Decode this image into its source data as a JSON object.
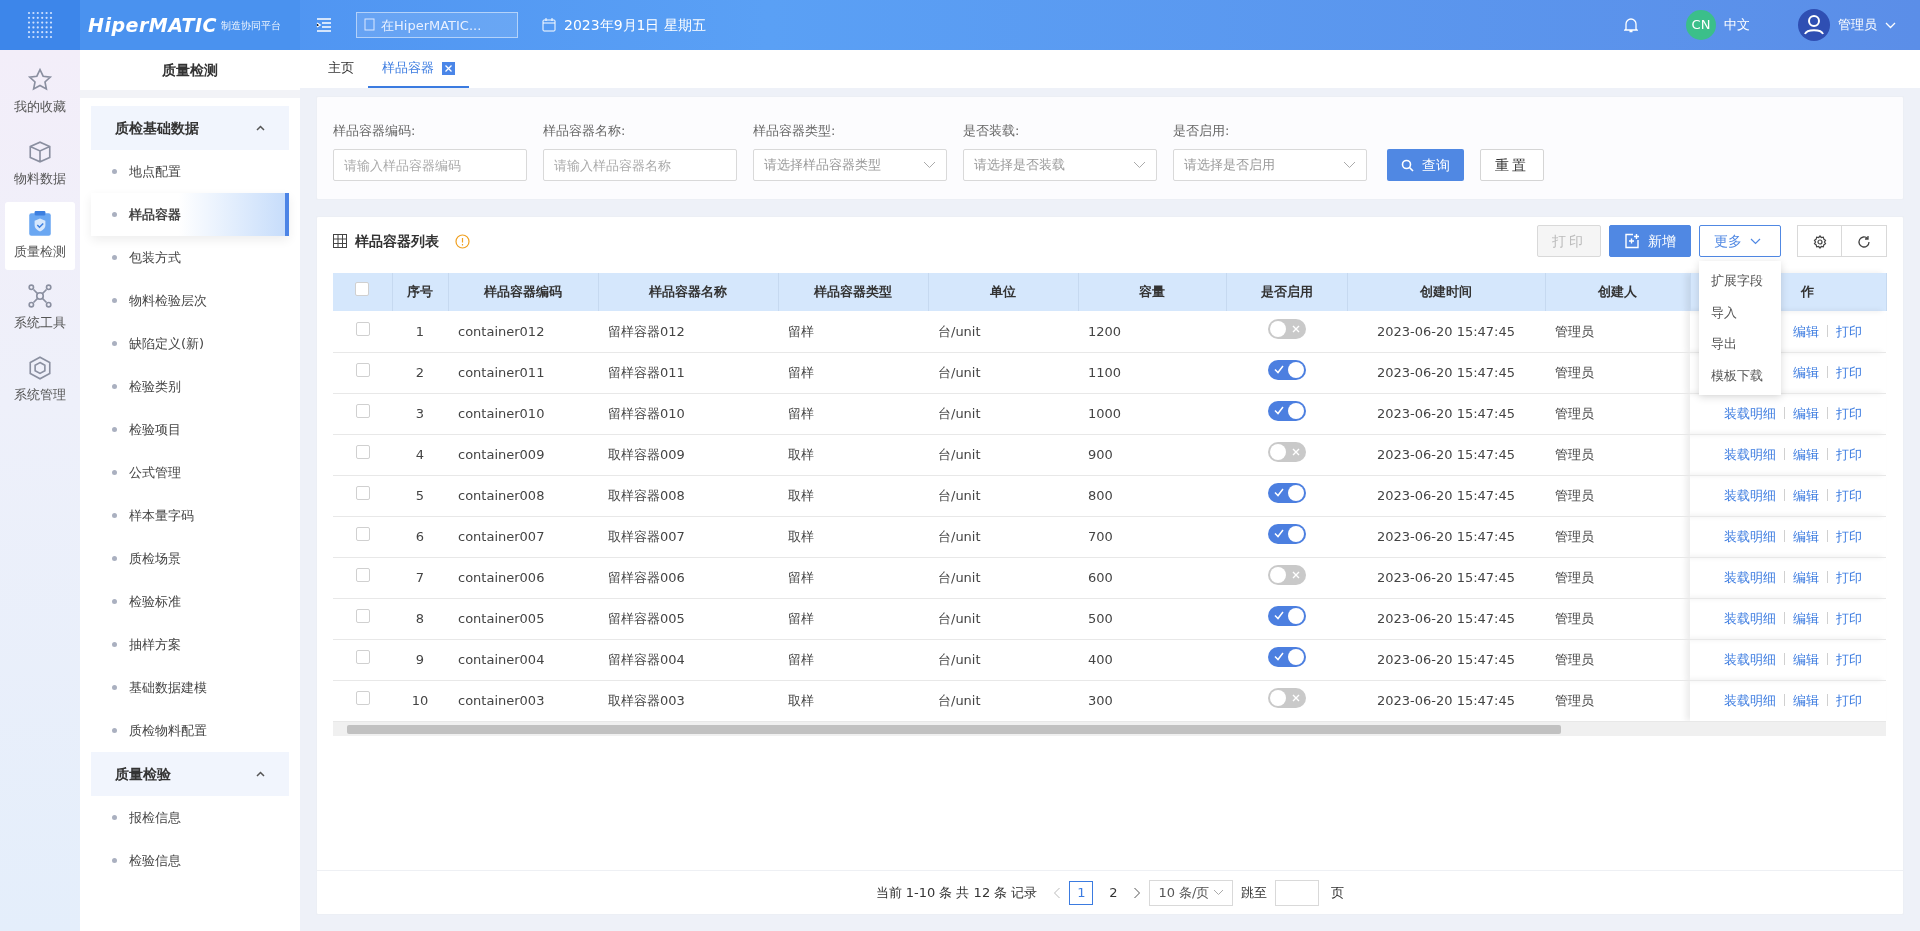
{
  "topbar": {
    "brand": "HiperMATIC",
    "subtitle": "制造协同平台",
    "search": {
      "placeholder": "在HiperMATIC..."
    },
    "date": "2023年9月1日 星期五",
    "language_badge": "CN",
    "language": "中文",
    "user": "管理员"
  },
  "rail": [
    {
      "label": "我的收藏",
      "selected": false
    },
    {
      "label": "物料数据",
      "selected": false
    },
    {
      "label": "质量检测",
      "selected": true
    },
    {
      "label": "系统工具",
      "selected": false
    },
    {
      "label": "系统管理",
      "selected": false
    }
  ],
  "sidebar": {
    "title": "质量检测",
    "groups": [
      {
        "label": "质检基础数据",
        "expanded": true,
        "children": [
          {
            "label": "地点配置",
            "selected": false
          },
          {
            "label": "样品容器",
            "selected": true
          },
          {
            "label": "包装方式",
            "selected": false
          },
          {
            "label": "物料检验层次",
            "selected": false
          },
          {
            "label": "缺陷定义(新)",
            "selected": false
          },
          {
            "label": "检验类别",
            "selected": false
          },
          {
            "label": "检验项目",
            "selected": false
          },
          {
            "label": "公式管理",
            "selected": false
          },
          {
            "label": "样本量字码",
            "selected": false
          },
          {
            "label": "质检场景",
            "selected": false
          },
          {
            "label": "检验标准",
            "selected": false
          },
          {
            "label": "抽样方案",
            "selected": false
          },
          {
            "label": "基础数据建模",
            "selected": false
          },
          {
            "label": "质检物料配置",
            "selected": false
          }
        ]
      },
      {
        "label": "质量检验",
        "expanded": true,
        "children": [
          {
            "label": "报检信息",
            "selected": false
          },
          {
            "label": "检验信息",
            "selected": false
          }
        ]
      }
    ]
  },
  "tabs": [
    {
      "label": "主页",
      "selected": false,
      "closable": false
    },
    {
      "label": "样品容器",
      "selected": true,
      "closable": true
    }
  ],
  "filters": [
    {
      "label": "样品容器编码:",
      "placeholder": "请输入样品容器编码",
      "kind": "input"
    },
    {
      "label": "样品容器名称:",
      "placeholder": "请输入样品容器名称",
      "kind": "input"
    },
    {
      "label": "样品容器类型:",
      "placeholder": "请选择样品容器类型",
      "kind": "select"
    },
    {
      "label": "是否装载:",
      "placeholder": "请选择是否装载",
      "kind": "select"
    },
    {
      "label": "是否启用:",
      "placeholder": "请选择是否启用",
      "kind": "select"
    }
  ],
  "filter_buttons": [
    {
      "label": "查询",
      "kind": "primary"
    },
    {
      "label": "重置",
      "kind": "default"
    }
  ],
  "list": {
    "title": "样品容器列表",
    "toolbar": [
      {
        "label": "打印",
        "kind": "default",
        "disabled": true
      },
      {
        "label": "新增",
        "kind": "primary",
        "disabled": false
      },
      {
        "label": "更多",
        "kind": "menu",
        "disabled": false,
        "expanded": true
      }
    ],
    "menu": [
      "扩展字段",
      "导入",
      "导出",
      "模板下载"
    ],
    "all_checked": false,
    "columns": [
      "序号",
      "样品容器编码",
      "样品容器名称",
      "样品容器类型",
      "单位",
      "容量",
      "是否启用",
      "创建时间",
      "创建人",
      "作"
    ],
    "rows": [
      {
        "no": "1",
        "checked": false,
        "code": "container012",
        "name": "留样容器012",
        "type": "留样",
        "unit": "台/unit",
        "capacity": "1200",
        "enabled": false,
        "created": "2023-06-20 15:47:45",
        "creator": "管理员",
        "actions": [
          "编辑",
          "打印"
        ]
      },
      {
        "no": "2",
        "checked": false,
        "code": "container011",
        "name": "留样容器011",
        "type": "留样",
        "unit": "台/unit",
        "capacity": "1100",
        "enabled": true,
        "created": "2023-06-20 15:47:45",
        "creator": "管理员",
        "actions": [
          "编辑",
          "打印"
        ]
      },
      {
        "no": "3",
        "checked": false,
        "code": "container010",
        "name": "留样容器010",
        "type": "留样",
        "unit": "台/unit",
        "capacity": "1000",
        "enabled": true,
        "created": "2023-06-20 15:47:45",
        "creator": "管理员",
        "actions": [
          "装载明细",
          "编辑",
          "打印"
        ]
      },
      {
        "no": "4",
        "checked": false,
        "code": "container009",
        "name": "取样容器009",
        "type": "取样",
        "unit": "台/unit",
        "capacity": "900",
        "enabled": false,
        "created": "2023-06-20 15:47:45",
        "creator": "管理员",
        "actions": [
          "装载明细",
          "编辑",
          "打印"
        ]
      },
      {
        "no": "5",
        "checked": false,
        "code": "container008",
        "name": "取样容器008",
        "type": "取样",
        "unit": "台/unit",
        "capacity": "800",
        "enabled": true,
        "created": "2023-06-20 15:47:45",
        "creator": "管理员",
        "actions": [
          "装载明细",
          "编辑",
          "打印"
        ]
      },
      {
        "no": "6",
        "checked": false,
        "code": "container007",
        "name": "取样容器007",
        "type": "取样",
        "unit": "台/unit",
        "capacity": "700",
        "enabled": true,
        "created": "2023-06-20 15:47:45",
        "creator": "管理员",
        "actions": [
          "装载明细",
          "编辑",
          "打印"
        ]
      },
      {
        "no": "7",
        "checked": false,
        "code": "container006",
        "name": "留样容器006",
        "type": "留样",
        "unit": "台/unit",
        "capacity": "600",
        "enabled": false,
        "created": "2023-06-20 15:47:45",
        "creator": "管理员",
        "actions": [
          "装载明细",
          "编辑",
          "打印"
        ]
      },
      {
        "no": "8",
        "checked": false,
        "code": "container005",
        "name": "留样容器005",
        "type": "留样",
        "unit": "台/unit",
        "capacity": "500",
        "enabled": true,
        "created": "2023-06-20 15:47:45",
        "creator": "管理员",
        "actions": [
          "装载明细",
          "编辑",
          "打印"
        ]
      },
      {
        "no": "9",
        "checked": false,
        "code": "container004",
        "name": "留样容器004",
        "type": "留样",
        "unit": "台/unit",
        "capacity": "400",
        "enabled": true,
        "created": "2023-06-20 15:47:45",
        "creator": "管理员",
        "actions": [
          "装载明细",
          "编辑",
          "打印"
        ]
      },
      {
        "no": "10",
        "checked": false,
        "code": "container003",
        "name": "取样容器003",
        "type": "取样",
        "unit": "台/unit",
        "capacity": "300",
        "enabled": false,
        "created": "2023-06-20 15:47:45",
        "creator": "管理员",
        "actions": [
          "装载明细",
          "编辑",
          "打印"
        ]
      }
    ]
  },
  "pagination": {
    "summary": "当前 1-10 条 共 12 条 记录",
    "pages": [
      {
        "label": "1",
        "selected": true
      },
      {
        "label": "2",
        "selected": false
      }
    ],
    "page_size": "10 条/页",
    "jump_label": "跳至",
    "jump_suffix": "页"
  }
}
